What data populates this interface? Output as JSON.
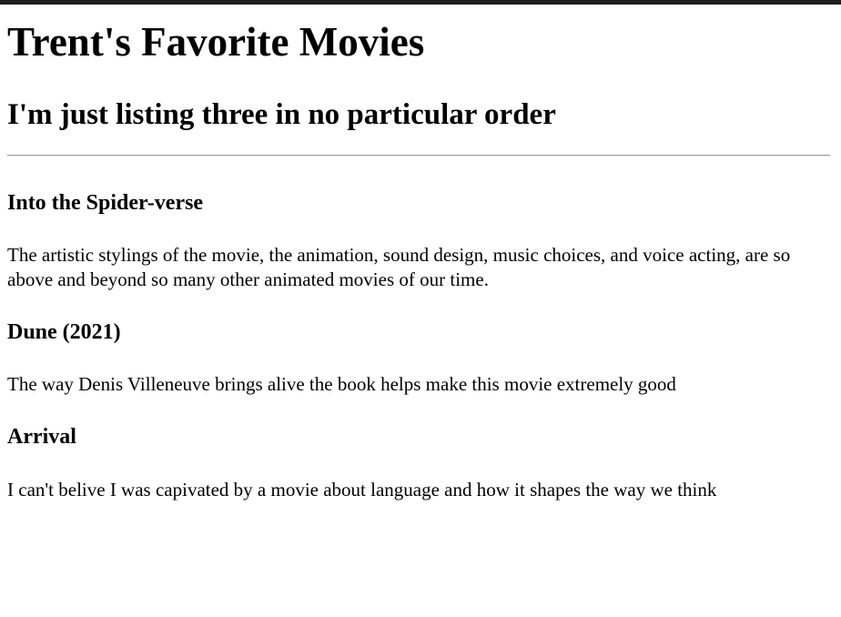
{
  "page": {
    "title": "Trent's Favorite Movies",
    "subtitle": "I'm just listing three in no particular order"
  },
  "movies": [
    {
      "title": "Into the Spider-verse",
      "description": "The artistic stylings of the movie, the animation, sound design, music choices, and voice acting, are so above and beyond so many other animated movies of our time."
    },
    {
      "title": "Dune (2021)",
      "description": "The way Denis Villeneuve brings alive the book helps make this movie extremely good"
    },
    {
      "title": "Arrival",
      "description": "I can't belive I was capivated by a movie about language and how it shapes the way we think"
    }
  ]
}
